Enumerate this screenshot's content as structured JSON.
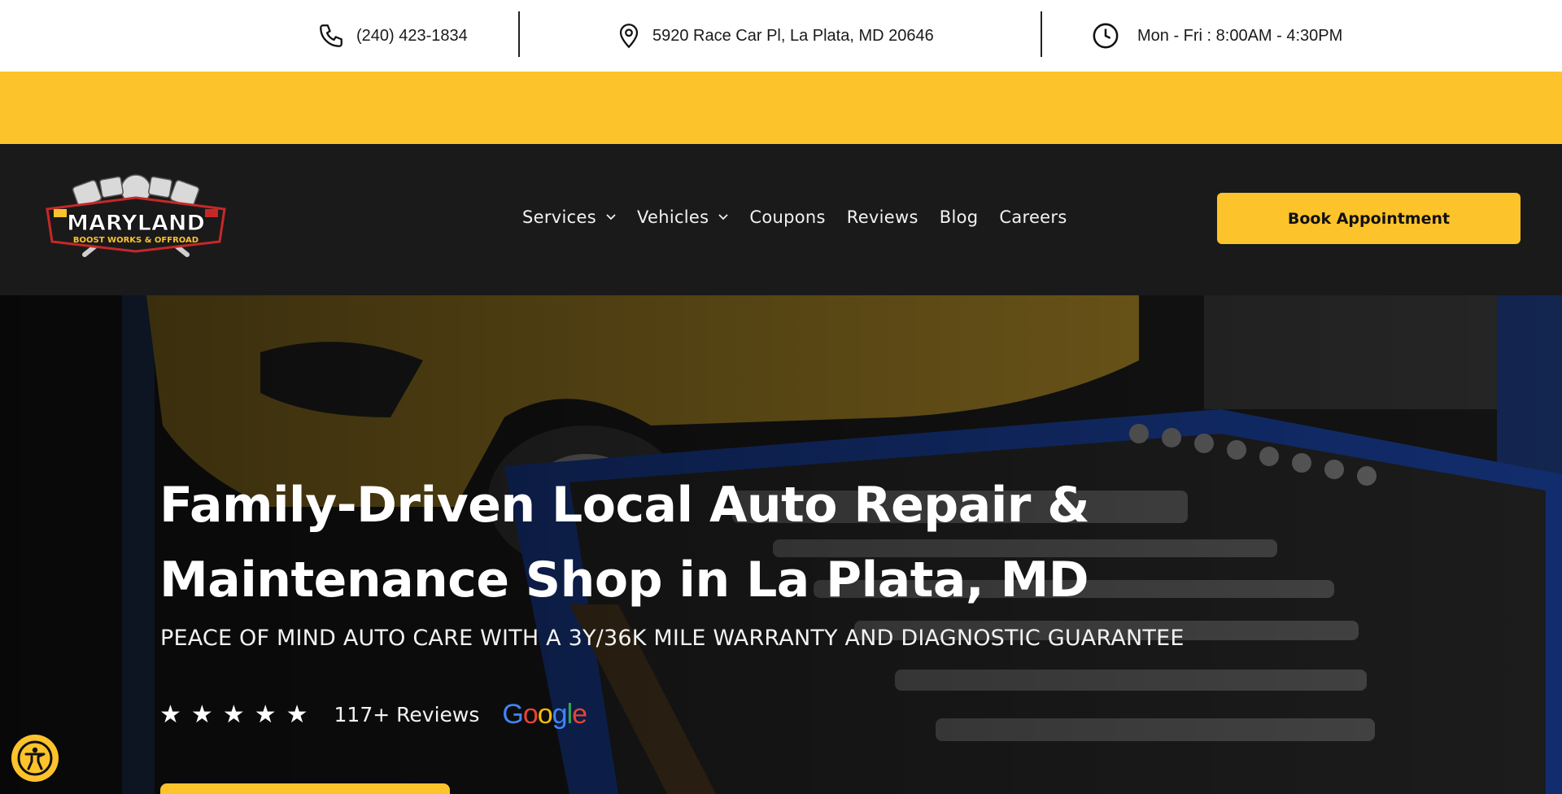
{
  "topbar": {
    "phone": "(240) 423-1834",
    "address": "5920 Race Car Pl, La Plata, MD 20646",
    "hours": "Mon - Fri : 8:00AM - 4:30PM",
    "icons": [
      "phone-icon",
      "location-pin-icon",
      "clock-icon"
    ]
  },
  "logo": {
    "main_text": "MARYLAND",
    "sub_text": "BOOST WORKS & OFFROAD"
  },
  "nav": {
    "items": [
      {
        "label": "Services",
        "has_dropdown": true
      },
      {
        "label": "Vehicles",
        "has_dropdown": true
      },
      {
        "label": "Coupons",
        "has_dropdown": false
      },
      {
        "label": "Reviews",
        "has_dropdown": false
      },
      {
        "label": "Blog",
        "has_dropdown": false
      },
      {
        "label": "Careers",
        "has_dropdown": false
      }
    ],
    "book_label": "Book Appointment"
  },
  "hero": {
    "title_line1": "Family-Driven Local Auto Repair &",
    "title_line2": "Maintenance Shop in  La Plata, MD",
    "subtitle": "PEACE OF MIND AUTO CARE WITH A 3Y/36K MILE WARRANTY AND DIAGNOSTIC GUARANTEE",
    "rating_stars": 5,
    "reviews_text": "117+ Reviews",
    "google_label": "Google"
  },
  "colors": {
    "accent": "#fdc32b",
    "navbar": "#1a1a1b",
    "topbar": "#ffffff",
    "text_light": "#ffffff"
  }
}
